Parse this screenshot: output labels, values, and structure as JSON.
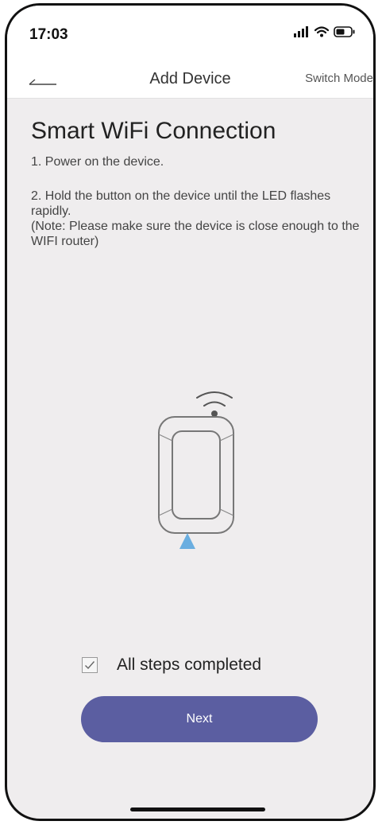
{
  "status_bar": {
    "time": "17:03",
    "icons": [
      "cellular-signal-icon",
      "wifi-icon",
      "battery-icon"
    ]
  },
  "nav": {
    "back_icon": "back-arrow-icon",
    "title": "Add Device",
    "switch_mode_label": "Switch Mode"
  },
  "main": {
    "heading": "Smart WiFi Connection",
    "step1": "1. Power on the device.",
    "step2": "2. Hold the button on the device until the LED flashes rapidly.",
    "note": "(Note: Please make sure the device is close enough to the WIFI router)",
    "illustration_icon": "wifi-device-illustration-icon",
    "checkbox_label": "All steps completed",
    "checkbox_checked": true,
    "next_label": "Next"
  },
  "colors": {
    "accent": "#5b5ea1",
    "indicator": "#6aaee0",
    "background": "#efedee"
  }
}
